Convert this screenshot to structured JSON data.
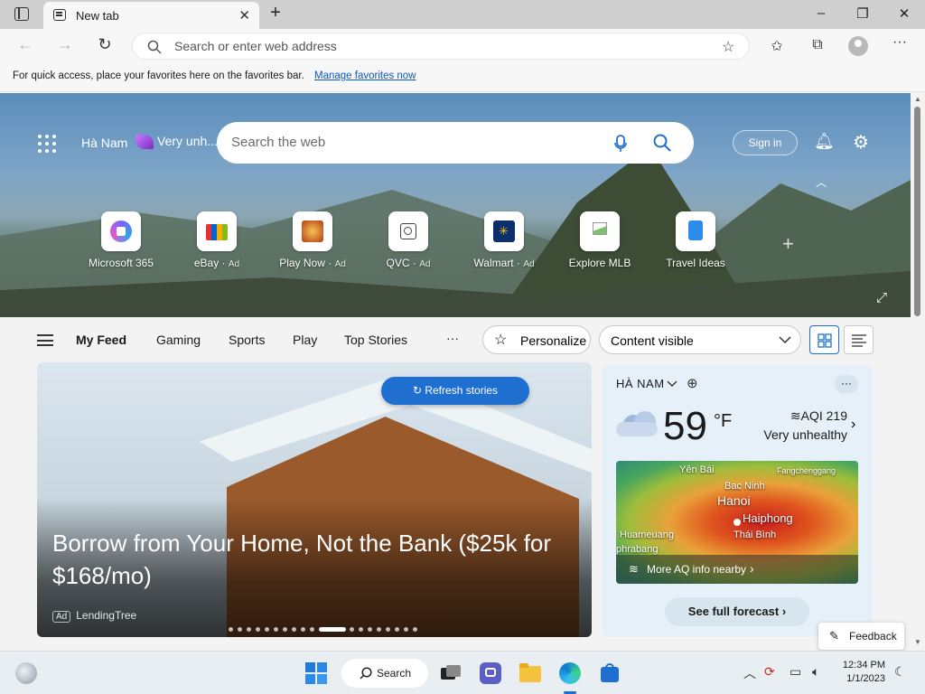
{
  "tab": {
    "title": "New tab"
  },
  "address": {
    "placeholder": "Search or enter web address"
  },
  "favorites_bar": {
    "text": "For quick access, place your favorites here on the favorites bar.",
    "link": "Manage favorites now"
  },
  "hero": {
    "location": "Hà Nam",
    "air_quality_short": "Very unh...",
    "search_placeholder": "Search the web",
    "sign_in": "Sign in",
    "tiles": [
      {
        "label": "Microsoft 365",
        "ad": ""
      },
      {
        "label": "eBay",
        "ad": "Ad"
      },
      {
        "label": "Play Now",
        "ad": "Ad"
      },
      {
        "label": "QVC",
        "ad": "Ad"
      },
      {
        "label": "Walmart",
        "ad": "Ad"
      },
      {
        "label": "Explore MLB",
        "ad": ""
      },
      {
        "label": "Travel Ideas",
        "ad": ""
      }
    ]
  },
  "feed_nav": {
    "items": [
      "My Feed",
      "Gaming",
      "Sports",
      "Play",
      "Top Stories"
    ],
    "more": "···",
    "personalize": "Personalize",
    "content_visible": "Content visible"
  },
  "story": {
    "headline": "Borrow from Your Home, Not the Bank ($25k for $168/mo)",
    "ad_badge": "Ad",
    "source": "LendingTree",
    "refresh": "Refresh stories",
    "slide_count": 19,
    "active_slide": 10
  },
  "weather": {
    "city": "HÀ NAM",
    "temp": "59",
    "unit": "°F",
    "aqi": "AQI 219",
    "aqi_status": "Very unhealthy",
    "map_labels": [
      "Yên Bái",
      "Bac Ninh",
      "Fangchenggang",
      "Hanoi",
      "Haiphong",
      "Huameuang",
      "Thái Bình",
      "phrabang"
    ],
    "more_aq": "More AQ info nearby",
    "forecast": "See full forecast",
    "more_dots": "···"
  },
  "feedback": "Feedback",
  "taskbar": {
    "search": "Search",
    "time": "12:34 PM",
    "date": "1/1/2023"
  },
  "colors": {
    "accent": "#1e6fd0",
    "link": "#0a59c2"
  }
}
